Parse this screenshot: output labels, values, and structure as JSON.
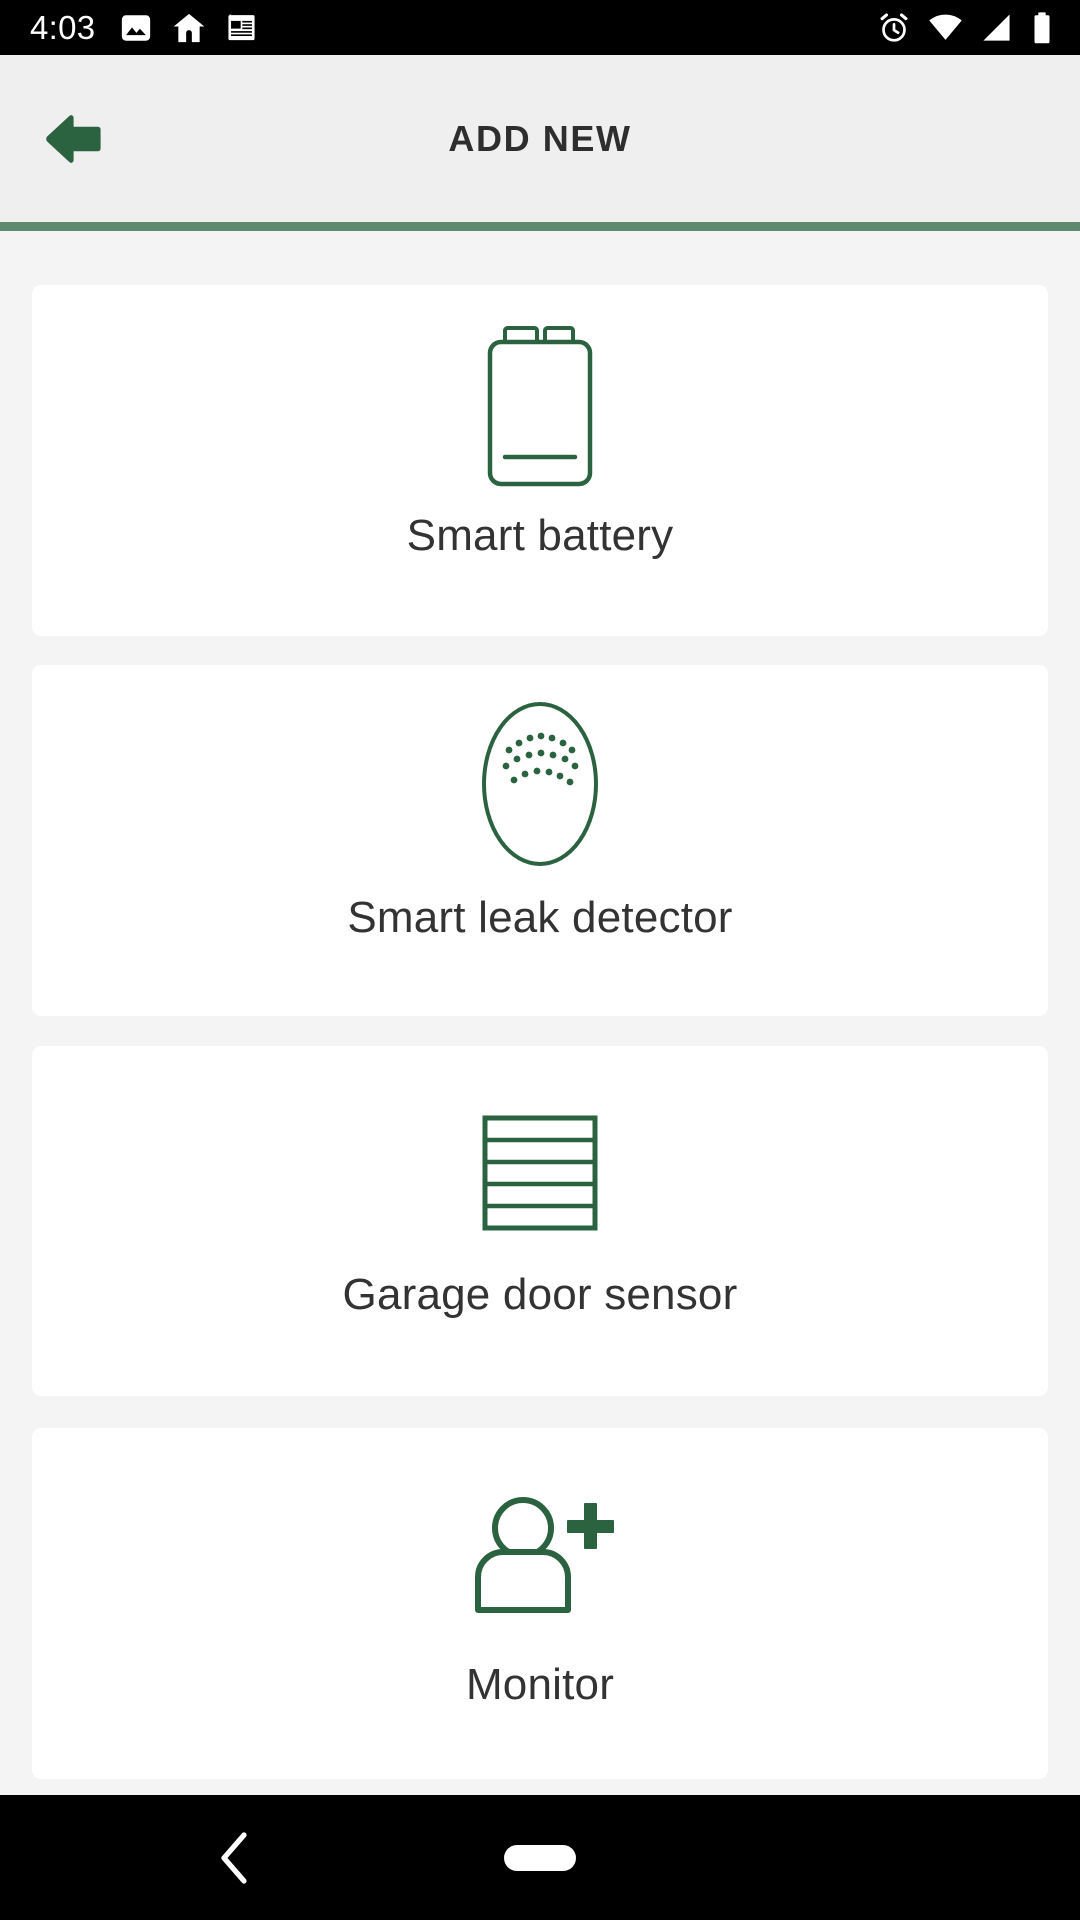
{
  "status_bar": {
    "clock": "4:03",
    "left_icons": [
      "image-icon",
      "home-icon",
      "news-icon"
    ],
    "right_icons": [
      "alarm-icon",
      "wifi-icon",
      "cellular-signal-icon",
      "battery-icon"
    ],
    "background_color": "#000000",
    "foreground_color": "#ffffff"
  },
  "header": {
    "title": "ADD NEW",
    "back_icon": "arrow-left-icon",
    "background_color": "#efefef",
    "accent_color": "#2b6340",
    "divider_color": "#5d8a6e"
  },
  "theme": {
    "page_background": "#f4f4f4",
    "card_background": "#ffffff",
    "icon_green": "#2b6340",
    "label_color": "#333333"
  },
  "card_list": {
    "cards": [
      {
        "id": "smart-battery",
        "label": "Smart battery",
        "icon": "battery-9v-icon"
      },
      {
        "id": "smart-leak",
        "label": "Smart leak detector",
        "icon": "leak-detector-icon"
      },
      {
        "id": "garage-door",
        "label": "Garage door sensor",
        "icon": "garage-door-icon"
      },
      {
        "id": "monitor",
        "label": "Monitor",
        "icon": "add-person-icon"
      }
    ]
  },
  "bottom_nav": {
    "back_icon": "chevron-left-icon",
    "home_icon": "home-pill-indicator",
    "background_color": "#000000"
  }
}
